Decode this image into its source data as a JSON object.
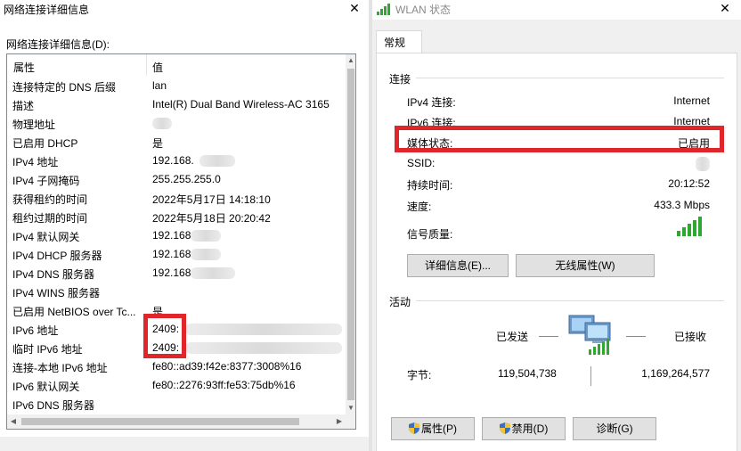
{
  "left_window": {
    "title": "网络连接详细信息",
    "list_label": "网络连接详细信息(D):",
    "columns": {
      "property": "属性",
      "value": "值"
    },
    "rows": [
      {
        "property": "连接特定的 DNS 后缀",
        "value": "lan"
      },
      {
        "property": "描述",
        "value": "Intel(R) Dual Band Wireless-AC 3165"
      },
      {
        "property": "物理地址",
        "value": ""
      },
      {
        "property": "已启用 DHCP",
        "value": "是"
      },
      {
        "property": "IPv4 地址",
        "value": "192.168."
      },
      {
        "property": "IPv4 子网掩码",
        "value": "255.255.255.0"
      },
      {
        "property": "获得租约的时间",
        "value": "2022年5月17日 14:18:10"
      },
      {
        "property": "租约过期的时间",
        "value": "2022年5月18日 20:20:42"
      },
      {
        "property": "IPv4 默认网关",
        "value": "192.168"
      },
      {
        "property": "IPv4 DHCP 服务器",
        "value": "192.168"
      },
      {
        "property": "IPv4 DNS 服务器",
        "value": "192.168"
      },
      {
        "property": "IPv4 WINS 服务器",
        "value": ""
      },
      {
        "property": "已启用 NetBIOS over Tc...",
        "value": "是"
      },
      {
        "property": "IPv6 地址",
        "value": "2409:"
      },
      {
        "property": "临时 IPv6 地址",
        "value": "2409:"
      },
      {
        "property": "连接-本地 IPv6 地址",
        "value": "fe80::ad39:f42e:8377:3008%16"
      },
      {
        "property": "IPv6 默认网关",
        "value": "fe80::2276:93ff:fe53:75db%16"
      },
      {
        "property": "IPv6 DNS 服务器",
        "value": ""
      }
    ]
  },
  "right_window": {
    "title": "WLAN 状态",
    "tab": "常规",
    "connection_group": "连接",
    "connection": [
      {
        "key": "IPv4 连接:",
        "value": "Internet"
      },
      {
        "key": "IPv6 连接:",
        "value": "Internet"
      },
      {
        "key": "媒体状态:",
        "value": "已启用"
      },
      {
        "key": "SSID:",
        "value": ""
      },
      {
        "key": "持续时间:",
        "value": "20:12:52"
      },
      {
        "key": "速度:",
        "value": "433.3 Mbps"
      },
      {
        "key": "信号质量:",
        "value": ""
      }
    ],
    "details_button": "详细信息(E)...",
    "wireless_button": "无线属性(W)",
    "activity_group": "活动",
    "sent_label": "已发送",
    "received_label": "已接收",
    "bytes_label": "字节:",
    "bytes_sent": "119,504,738",
    "bytes_received": "1,169,264,577",
    "properties_button": "属性(P)",
    "disable_button": "禁用(D)",
    "diagnose_button": "诊断(G)"
  },
  "colors": {
    "highlight_box": "#e0262b",
    "signal": "#2fa82f"
  },
  "icons": [
    "close-icon",
    "wifi-signal-icon",
    "network-computers-icon",
    "shield-icon"
  ]
}
